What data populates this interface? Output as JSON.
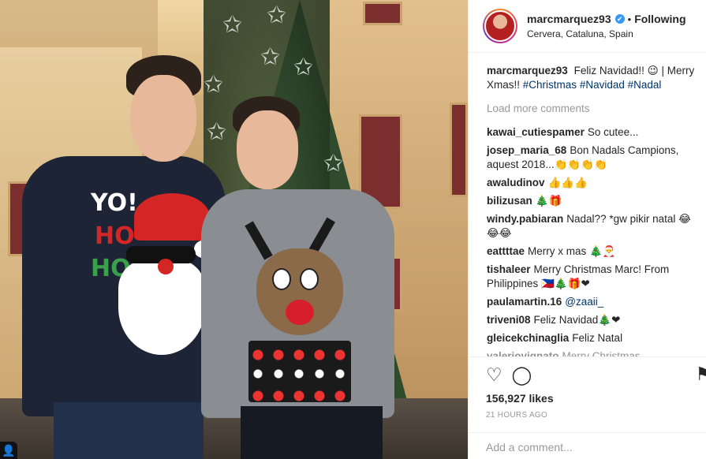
{
  "header": {
    "username": "marcmarquez93",
    "verified_icon": "✔",
    "separator": "•",
    "follow_label": "Following",
    "location": "Cervera, Cataluna, Spain"
  },
  "caption": {
    "username": "marcmarquez93",
    "text": "Feliz Navidad!! 😉 | Merry Xmas!!",
    "hashtags": [
      "#Christmas",
      "#Navidad",
      "#Nadal"
    ]
  },
  "load_more_label": "Load more comments",
  "comments": [
    {
      "user": "kawai_cutiespamer",
      "text": "So cutee..."
    },
    {
      "user": "josep_maria_68",
      "text": "Bon Nadals Campions, aquest 2018...👏👏👏👏"
    },
    {
      "user": "awaludinov",
      "text": "👍👍👍"
    },
    {
      "user": "bilizusan",
      "text": "🎄🎁"
    },
    {
      "user": "windy.pabiaran",
      "text": "Nadal?? *gw pikir natal 😂😂😂"
    },
    {
      "user": "eattttae",
      "text": "Merry x mas 🎄🎅"
    },
    {
      "user": "tishaleer",
      "text": "Merry Christmas Marc! From Philippines 🇵🇭🎄🎁❤"
    },
    {
      "user": "paulamartin.16",
      "text": "@zaaii_"
    },
    {
      "user": "triveni08",
      "text": "Feliz Navidad🎄❤"
    },
    {
      "user": "gleicekchinaglia",
      "text": "Feliz Natal"
    },
    {
      "user": "valeriovignato",
      "text": "Merry Christmas"
    }
  ],
  "actions": {
    "heart_icon": "♡",
    "comment_icon": "◯",
    "save_icon": "⚑",
    "likes": "156,927 likes",
    "time": "21 HOURS AGO"
  },
  "add_comment": {
    "placeholder": "Add a comment..."
  },
  "photo": {
    "sweater_text_1": "YO!",
    "sweater_text_2": "HO",
    "sweater_text_3": "HO",
    "user_icon": "👤"
  }
}
